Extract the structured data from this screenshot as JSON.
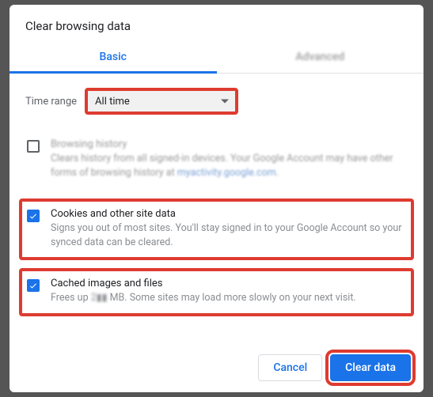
{
  "dialog": {
    "title": "Clear browsing data"
  },
  "tabs": {
    "basic": "Basic",
    "advanced": "Advanced"
  },
  "time_range": {
    "label": "Time range",
    "selected": "All time"
  },
  "rows": {
    "browsing_history": {
      "checked": false,
      "title": "Browsing history",
      "desc_1": "Clears history from all signed-in devices. Your Google Account may have other forms of browsing history at ",
      "link": "myactivity.google.com",
      "desc_2": "."
    },
    "cookies": {
      "checked": true,
      "title": "Cookies and other site data",
      "desc": "Signs you out of most sites. You'll stay signed in to your Google Account so your synced data can be cleared."
    },
    "cache": {
      "checked": true,
      "title": "Cached images and files",
      "desc_1": "Frees up ",
      "amount": "2▮▮",
      "desc_2": " MB. Some sites may load more slowly on your next visit."
    }
  },
  "footer": {
    "cancel": "Cancel",
    "clear": "Clear data"
  }
}
